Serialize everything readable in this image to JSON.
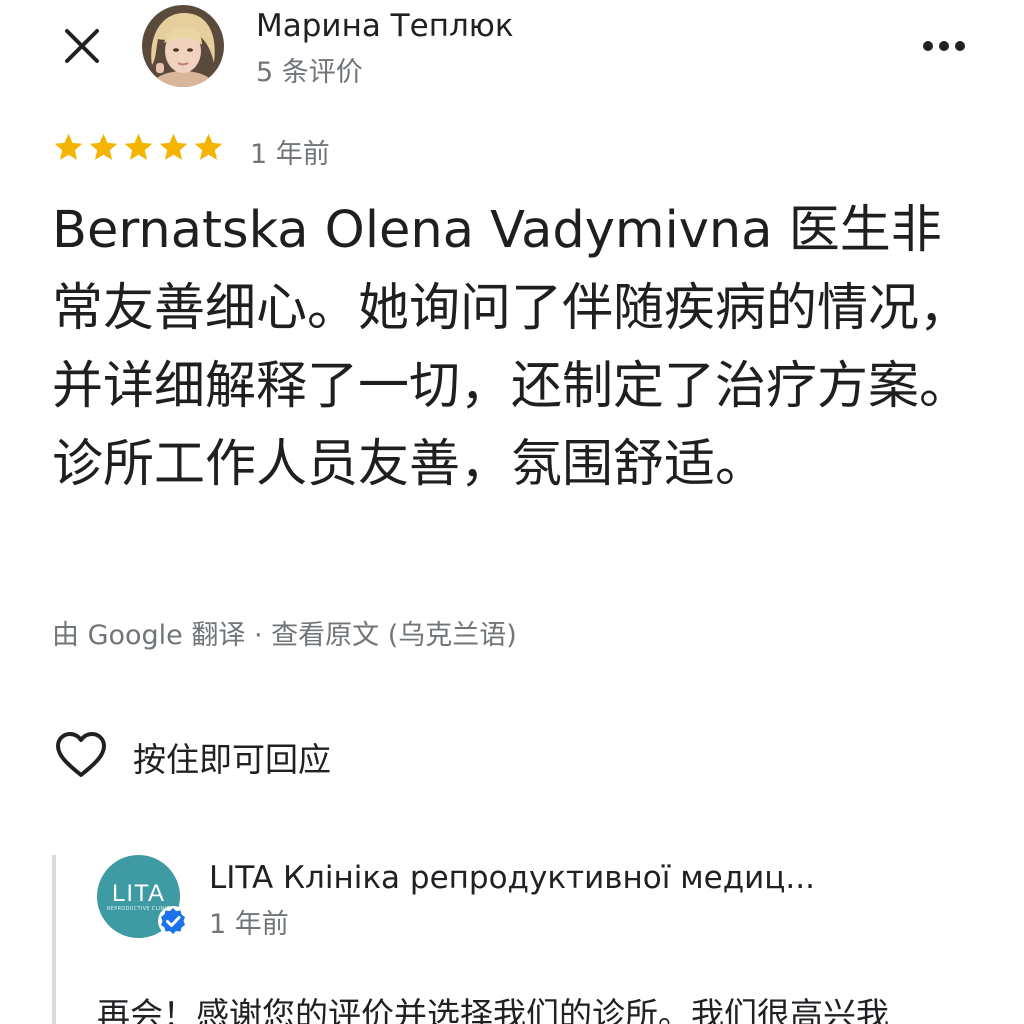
{
  "header": {
    "close_icon": "close-icon",
    "author_name": "Марина Теплюк",
    "review_count": "5 条评价",
    "more_icon": "more-horizontal-icon"
  },
  "rating": {
    "stars": 5,
    "max_stars": 5,
    "star_color": "#f4b400",
    "time_ago": "1 年前"
  },
  "review": {
    "text": "Bernatska Olena Vadymivna 医生非常友善细心。她询问了伴随疾病的情况，并详细解释了一切，还制定了治疗方案。诊所工作人员友善，氛围舒适。",
    "translation_prefix": "由 Google 翻译 · ",
    "translation_link": "查看原文 (乌克兰语)"
  },
  "actions": {
    "like_icon": "heart-outline-icon",
    "like_hint": "按住即可回应"
  },
  "owner_response": {
    "logo_text": "LITA",
    "logo_subtext": "REPRODUCTIVE CLINIC",
    "logo_color": "#3e9aa3",
    "verified_icon": "verified-badge-icon",
    "verified_color": "#1a73e8",
    "name": "LITA Клініка репродуктивної медиц...",
    "time_ago": "1 年前",
    "reply_text": "再会！感谢您的评价并选择我们的诊所。我们很高兴我"
  }
}
